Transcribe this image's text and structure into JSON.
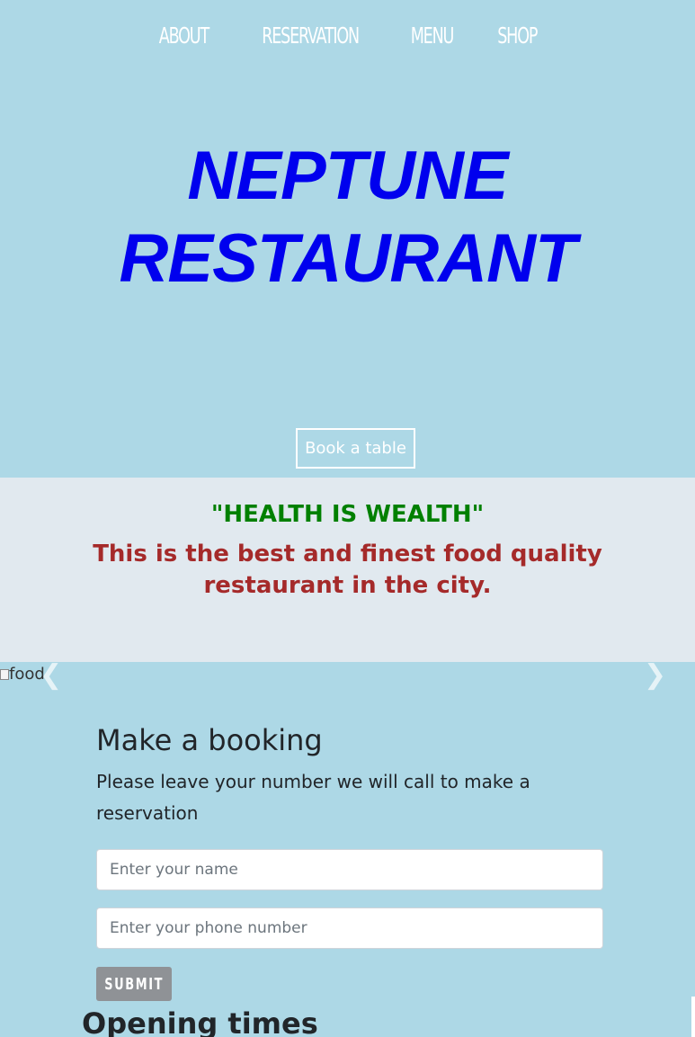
{
  "nav": {
    "items": [
      "ABOUT",
      "RESERVATION",
      "MENU",
      "SHOP"
    ]
  },
  "hero": {
    "title_line1": "NEPTUNE",
    "title_line2": "RESTAURANT",
    "book_button": "Book a table"
  },
  "quote_band": {
    "quote": "\"HEALTH IS WEALTH\"",
    "tagline": "This is the best and finest food quality restaurant in the city."
  },
  "carousel": {
    "image_alt": "food",
    "prev_icon": "chevron-left-icon",
    "next_icon": "chevron-right-icon"
  },
  "booking": {
    "heading": "Make a booking",
    "description": "Please leave your number we will call to make a reservation",
    "name_placeholder": "Enter your name",
    "phone_placeholder": "Enter your phone number",
    "submit_label": "SUBMIT"
  },
  "opening": {
    "heading": "Opening times"
  },
  "colors": {
    "background": "#add8e6",
    "title": "#0000ee",
    "quote": "#008000",
    "tagline": "#a52a2a",
    "band": "#e1e9ef",
    "submit": "#8f9296"
  }
}
